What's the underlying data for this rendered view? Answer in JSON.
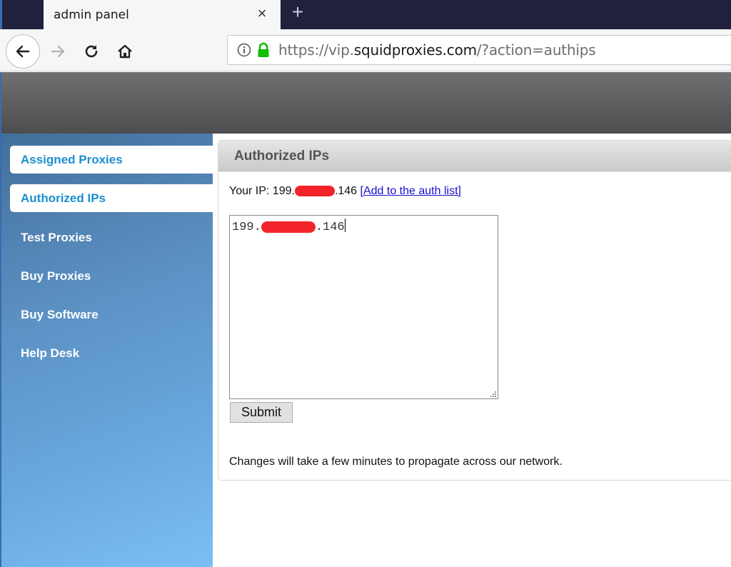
{
  "browser": {
    "tab": {
      "title": "admin panel",
      "close_glyph": "×"
    },
    "new_tab_glyph": "+",
    "url": {
      "prefix": "https://vip.",
      "host": "squidproxies.com",
      "suffix": "/?action=authips"
    },
    "icons": [
      "back-arrow-icon",
      "forward-arrow-icon",
      "reload-icon",
      "home-icon",
      "info-icon",
      "lock-icon"
    ],
    "colors": {
      "tabstrip": "#1f213d",
      "lock": "#12bc00"
    }
  },
  "sidebar": {
    "items": [
      {
        "label": "Assigned Proxies",
        "state": "highlighted"
      },
      {
        "label": "Authorized IPs",
        "state": "active"
      },
      {
        "label": "Test Proxies",
        "state": "normal"
      },
      {
        "label": "Buy Proxies",
        "state": "normal"
      },
      {
        "label": "Buy Software",
        "state": "normal"
      },
      {
        "label": "Help Desk",
        "state": "normal"
      }
    ],
    "active_color": "#1b8fd0"
  },
  "panel": {
    "title": "Authorized IPs",
    "your_ip_label": "Your IP:",
    "ip_prefix": "199.",
    "ip_suffix": ".146",
    "ip_redacted": true,
    "add_link": "[Add to the auth list]",
    "textarea": {
      "value_prefix": "199.",
      "value_suffix": ".146",
      "redacted": true
    },
    "submit_label": "Submit",
    "note": "Changes will take a few minutes to propagate across our network."
  }
}
